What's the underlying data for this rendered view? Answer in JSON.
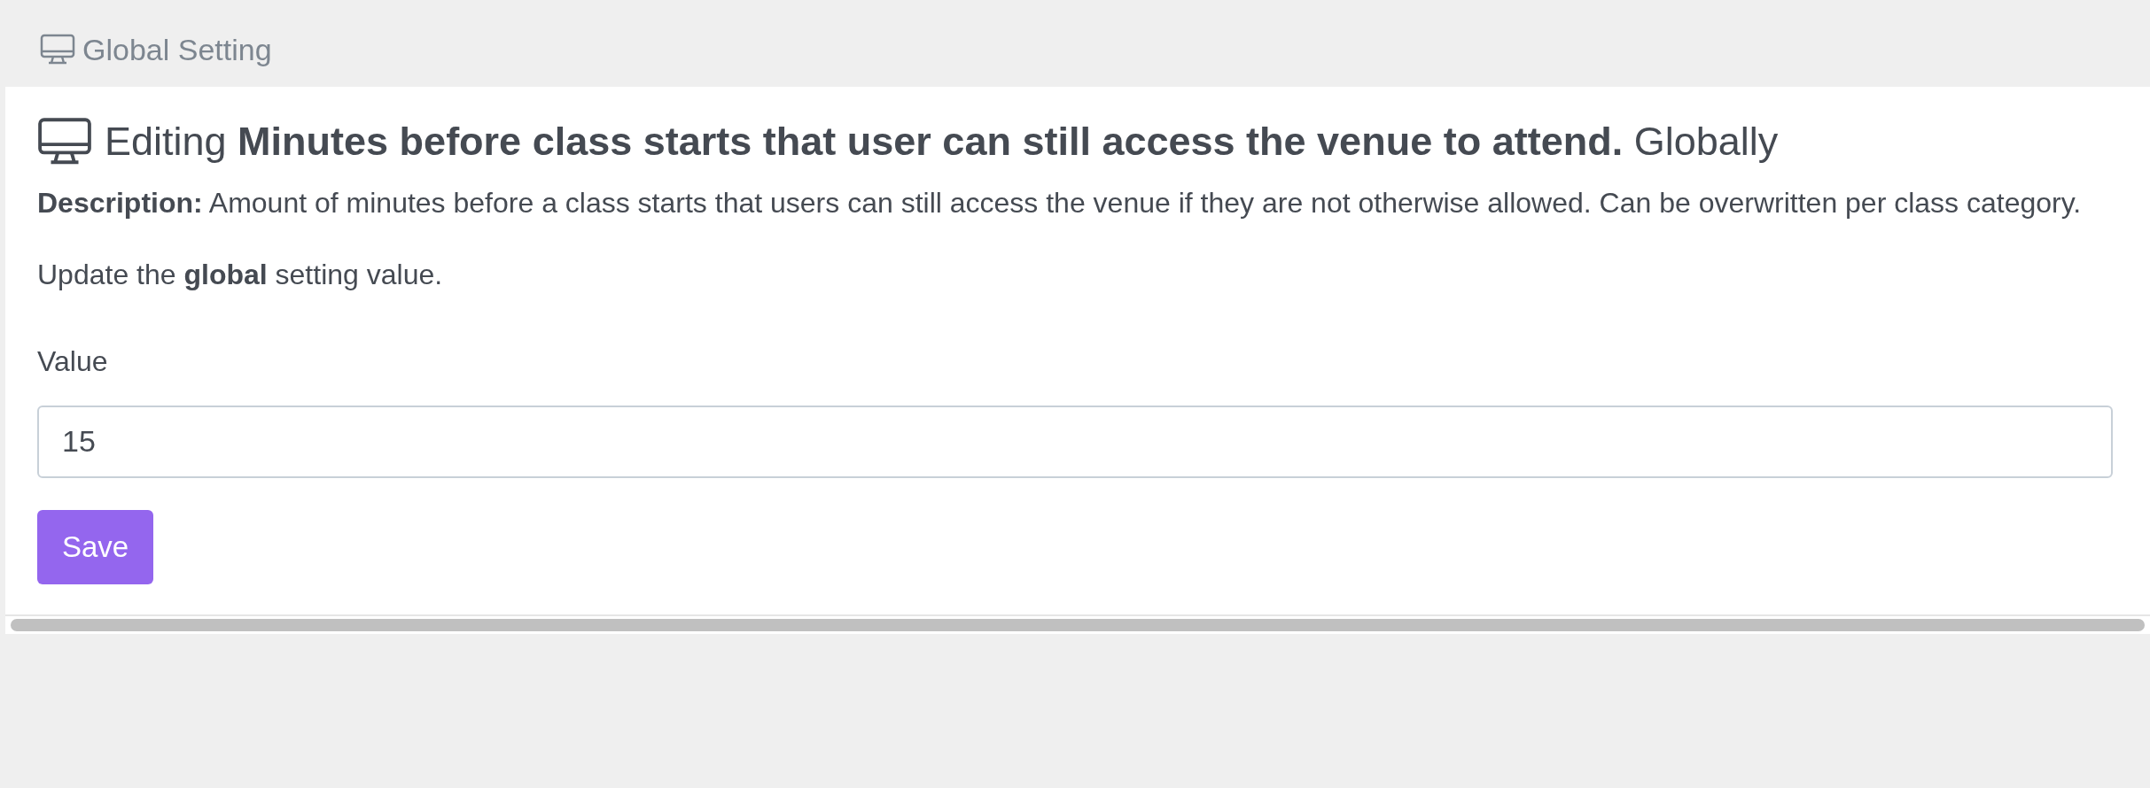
{
  "breadcrumb": {
    "label": "Global Setting"
  },
  "heading": {
    "prefix": "Editing",
    "setting_name": "Minutes before class starts that user can still access the venue to attend.",
    "suffix": "Globally"
  },
  "description": "**Description:** Amount of minutes before a class starts that users can still access the venue if they are not otherwise allowed. Can be overwritten per class category.",
  "instruction": "Update the **global** setting value.",
  "field": {
    "label": "Value",
    "value": "15"
  },
  "buttons": [
    "Save"
  ]
}
